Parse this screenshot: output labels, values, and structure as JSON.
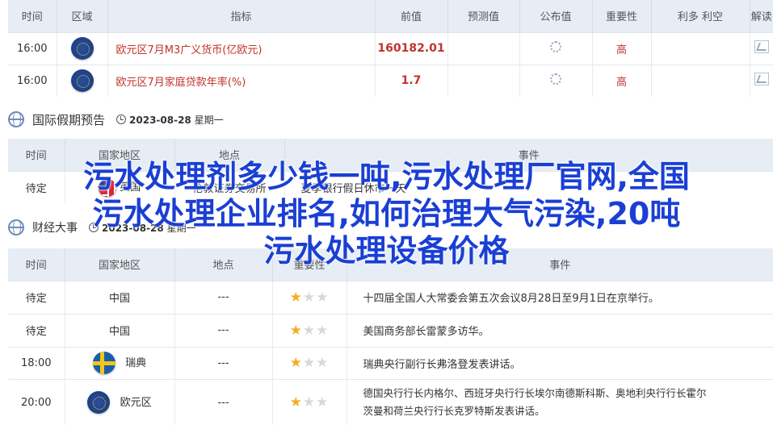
{
  "indicators_table": {
    "headers": [
      "时间",
      "区域",
      "指标",
      "前值",
      "预测值",
      "公布值",
      "重要性",
      "利多 利空",
      "解读"
    ],
    "rows": [
      {
        "time": "16:00",
        "region_flag": "eu-flag",
        "indicator": "欧元区7月M3广义货币(亿欧元)",
        "previous": "160182.01",
        "importance": "高"
      },
      {
        "time": "16:00",
        "region_flag": "eu-flag",
        "indicator": "欧元区7月家庭贷款年率(%)",
        "previous": "1.7",
        "importance": "高"
      }
    ]
  },
  "holiday_section": {
    "title": "国际假期预告",
    "date": "2023-08-28",
    "weekday": "星期一",
    "headers": [
      "时间",
      "国家地区",
      "地点",
      "事件"
    ],
    "rows": [
      {
        "time": "待定",
        "country": "英国",
        "place": "伦敦证券交易所",
        "event": "夏季银行假日休市一天"
      }
    ]
  },
  "econ_section": {
    "title": "财经大事",
    "date": "2023-08-28",
    "weekday": "星期一"
  },
  "events_table": {
    "headers": [
      "时间",
      "国家地区",
      "地点",
      "重要性",
      "事件"
    ],
    "rows": [
      {
        "time": "待定",
        "country": "中国",
        "place": "---",
        "stars": 1,
        "event": "十四届全国人大常委会第五次会议8月28日至9月1日在京举行。"
      },
      {
        "time": "待定",
        "country": "中国",
        "place": "---",
        "stars": 1,
        "event": "美国商务部长雷蒙多访华。"
      },
      {
        "time": "18:00",
        "country": "瑞典",
        "place": "---",
        "stars": 1,
        "event": "瑞典央行副行长弗洛登发表讲话。"
      },
      {
        "time": "20:00",
        "country": "欧元区",
        "place": "---",
        "stars": 1,
        "event_line1": "德国央行行长内格尔、西班牙央行行长埃尔南德斯科斯、奥地利央行行长霍尔",
        "event_line2": "茨曼和荷兰央行行长克罗特斯发表讲话。"
      }
    ]
  },
  "overlay": {
    "line1": "污水处理剂多少钱一吨,污水处理厂官网,全国",
    "line2": "污水处理企业排名,如何治理大气污染,20吨",
    "line3": "污水处理设备价格"
  }
}
